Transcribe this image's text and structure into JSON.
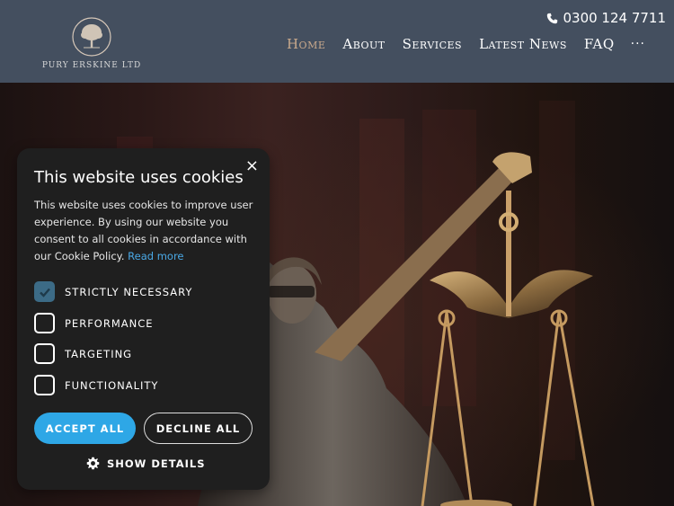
{
  "brand": {
    "name": "PURY ERSKINE LTD",
    "logo_icon": "tree-icon"
  },
  "header": {
    "phone": "0300 124 7711",
    "phone_icon": "phone-icon",
    "nav": [
      {
        "label": "Home",
        "active": true
      },
      {
        "label": "About",
        "active": false
      },
      {
        "label": "Services",
        "active": false
      },
      {
        "label": "Latest News",
        "active": false
      },
      {
        "label": "FAQ",
        "active": false
      }
    ],
    "more": "···"
  },
  "cookie_banner": {
    "title": "This website uses cookies",
    "body": "This website uses cookies to improve user experience. By using our website you consent to all cookies in accordance with our Cookie Policy.",
    "link": "Read more",
    "options": [
      {
        "label": "STRICTLY NECESSARY",
        "checked": true
      },
      {
        "label": "PERFORMANCE",
        "checked": false
      },
      {
        "label": "TARGETING",
        "checked": false
      },
      {
        "label": "FUNCTIONALITY",
        "checked": false
      }
    ],
    "accept_label": "ACCEPT ALL",
    "decline_label": "DECLINE ALL",
    "details_label": "SHOW DETAILS",
    "close_symbol": "×"
  },
  "colors": {
    "header_bg": "#444f5f",
    "accent_blue": "#2ea7e6",
    "active_nav": "#c9a98c",
    "checkbox_checked": "#3c6b86"
  }
}
